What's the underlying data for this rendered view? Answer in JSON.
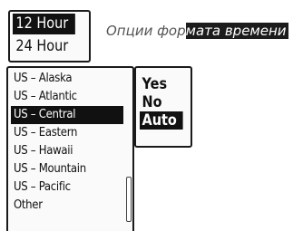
{
  "time_format": {
    "options": [
      {
        "label": "12 Hour",
        "selected": true
      },
      {
        "label": "24 Hour",
        "selected": false
      }
    ]
  },
  "caption": {
    "part1": "Опции фор",
    "part2": "мата времени"
  },
  "timezone": {
    "options": [
      {
        "label": "US – Alaska",
        "selected": false
      },
      {
        "label": "US – Atlantic",
        "selected": false
      },
      {
        "label": "US – Central",
        "selected": true
      },
      {
        "label": "US – Eastern",
        "selected": false
      },
      {
        "label": "US – Hawaii",
        "selected": false
      },
      {
        "label": "US – Mountain",
        "selected": false
      },
      {
        "label": "US – Pacific",
        "selected": false
      },
      {
        "label": "Other",
        "selected": false
      }
    ]
  },
  "daylight_saving": {
    "options": [
      {
        "label": "Yes",
        "selected": false
      },
      {
        "label": "No",
        "selected": false
      },
      {
        "label": "Auto",
        "selected": true
      }
    ]
  },
  "colors": {
    "selection_bg": "#111111",
    "selection_fg": "#ffffff",
    "caption_fg": "#555555"
  }
}
